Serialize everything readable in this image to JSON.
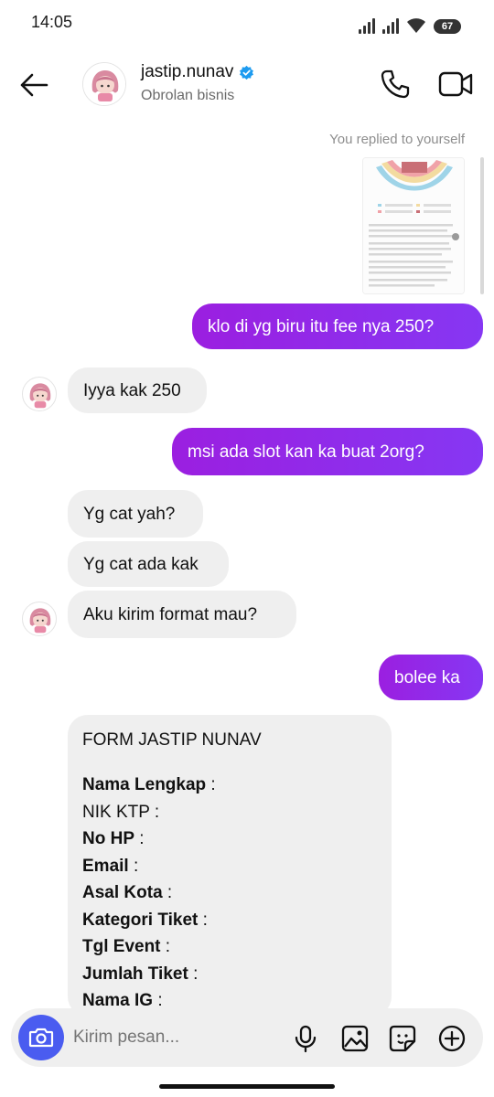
{
  "status": {
    "time": "14:05",
    "battery": "67"
  },
  "header": {
    "username": "jastip.nunav",
    "subtitle": "Obrolan bisnis",
    "verified_color": "#1d9bf0"
  },
  "reply_label": "You replied to yourself",
  "messages": [
    {
      "from": "me",
      "text": "klo di yg biru itu fee nya 250?"
    },
    {
      "from": "them",
      "text": "Iyya kak 250"
    },
    {
      "from": "me",
      "text": "msi ada slot kan ka buat 2org?"
    },
    {
      "from": "them",
      "text": "Yg cat yah?"
    },
    {
      "from": "them",
      "text": "Yg cat ada kak"
    },
    {
      "from": "them",
      "text": "Aku kirim format mau?"
    },
    {
      "from": "me",
      "text": "bolee ka"
    }
  ],
  "form": {
    "title": "FORM JASTIP NUNAV",
    "fields": [
      {
        "label": "Nama Lengkap",
        "bold": true
      },
      {
        "label": "NIK KTP",
        "bold": false
      },
      {
        "label": "No HP",
        "bold": true
      },
      {
        "label": "Email",
        "bold": true
      },
      {
        "label": "Asal Kota",
        "bold": true
      },
      {
        "label": "Kategori Tiket",
        "bold": true
      },
      {
        "label": "Tgl Event",
        "bold": true
      },
      {
        "label": "Jumlah Tiket",
        "bold": true
      },
      {
        "label": "Nama IG",
        "bold": true
      }
    ],
    "separator": " :"
  },
  "composer": {
    "placeholder": "Kirim pesan..."
  },
  "colors": {
    "accent_purple": "#8a2be2",
    "camera_blue": "#4a5cf0",
    "bubble_gray": "#efefef"
  }
}
